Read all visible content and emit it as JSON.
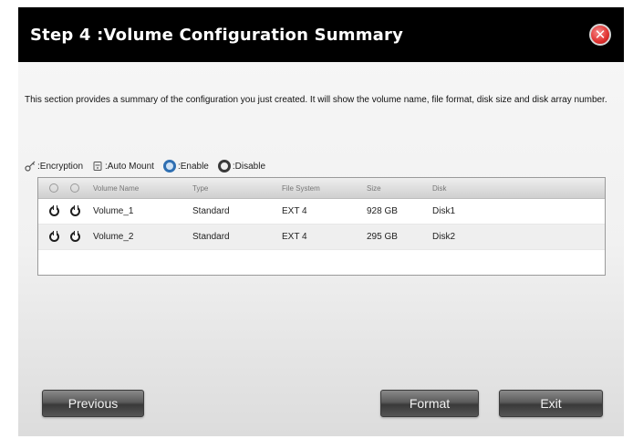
{
  "window": {
    "title": "Step 4 :Volume Configuration Summary"
  },
  "description": "This section provides a summary of the configuration you just created. It will show the volume name, file format, disk size and disk array number.",
  "legend": {
    "encryption": ":Encryption",
    "auto_mount": ":Auto Mount",
    "enable": ":Enable",
    "disable": ":Disable"
  },
  "table": {
    "columns": [
      "Volume Name",
      "Type",
      "File System",
      "Size",
      "Disk"
    ],
    "rows": [
      {
        "name": "Volume_1",
        "type": "Standard",
        "fs": "EXT 4",
        "size": "928 GB",
        "disk": "Disk1"
      },
      {
        "name": "Volume_2",
        "type": "Standard",
        "fs": "EXT 4",
        "size": "295 GB",
        "disk": "Disk2"
      }
    ]
  },
  "buttons": {
    "previous": "Previous",
    "format": "Format",
    "exit": "Exit"
  },
  "icons": {
    "close": "close-icon",
    "encryption": "key-icon",
    "auto_mount": "drive-icon",
    "enable": "enable-icon",
    "disable": "disable-icon"
  },
  "colors": {
    "titlebar": "#000000",
    "close_button": "#e0312f",
    "enable": "#2f6fb2",
    "button": "#555555"
  }
}
